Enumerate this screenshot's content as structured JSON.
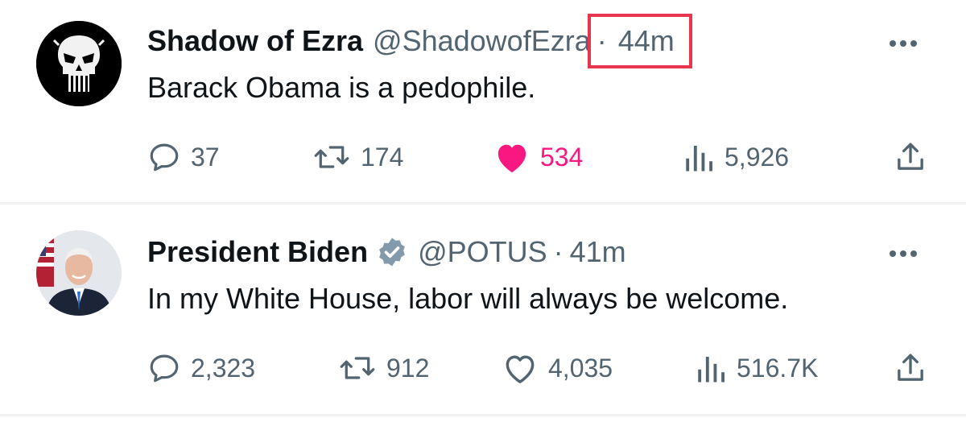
{
  "tweets": [
    {
      "display_name": "Shadow of Ezra",
      "handle": "@ShadowofEzra",
      "separator": "·",
      "time": "44m",
      "verified": false,
      "text": "Barack Obama is a pedophile.",
      "replies": "37",
      "retweets": "174",
      "likes": "534",
      "views": "5,926",
      "liked": true,
      "avatar_icon": "punisher-skull-avatar"
    },
    {
      "display_name": "President Biden",
      "handle": "@POTUS",
      "separator": "·",
      "time": "41m",
      "verified": true,
      "text": "In my White House, labor will always be welcome.",
      "replies": "2,323",
      "retweets": "912",
      "likes": "4,035",
      "views": "516.7K",
      "liked": false,
      "avatar_icon": "portrait-photo-avatar"
    }
  ],
  "colors": {
    "highlight_box": "#e8364f",
    "like_active": "#f91880",
    "muted_text": "#536471",
    "verified_badge": "#829aab"
  }
}
